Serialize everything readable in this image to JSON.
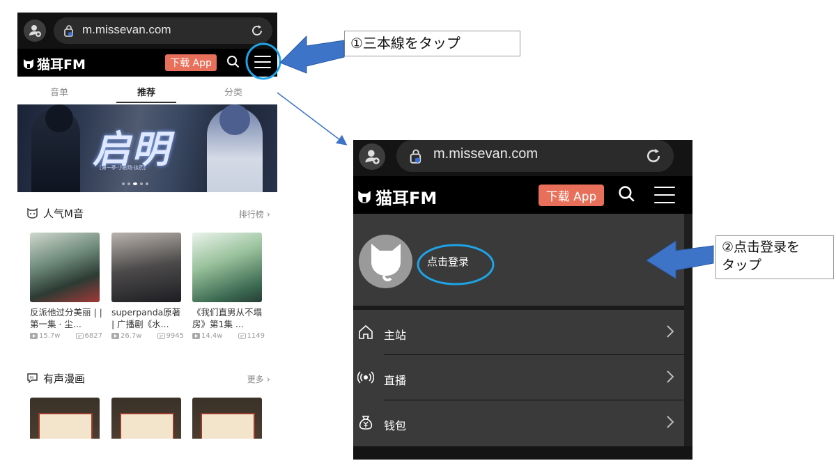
{
  "colors": {
    "accent": "#e8705a",
    "annotation_blue": "#3e74c8",
    "highlight_ring": "#1ea3e6",
    "dark_bg": "#121212",
    "panel_bg": "#3a3a3a"
  },
  "left_phone": {
    "url": "m.missevan.com",
    "app_name": "猫耳FM",
    "download_label": "下载 App",
    "tabs": [
      {
        "label": "音单",
        "active": false
      },
      {
        "label": "推荐",
        "active": true
      },
      {
        "label": "分类",
        "active": false
      }
    ],
    "banner": {
      "title": "启明",
      "subtitle": "[第一季·小剧场·挟药]"
    },
    "popular": {
      "title": "人气M音",
      "more": "排行榜",
      "cards": [
        {
          "title": "反派他过分美丽 | | 第一集 · 尘...",
          "plays": "15.7w",
          "comments": "6827"
        },
        {
          "title": "superpanda原著 | 广播剧《水...",
          "plays": "26.7w",
          "comments": "9945"
        },
        {
          "title": "《我们直男从不塌房》第1集 ...",
          "plays": "14.4w",
          "comments": "1149"
        }
      ]
    },
    "manga": {
      "title": "有声漫画",
      "more": "更多"
    }
  },
  "right_phone": {
    "url": "m.missevan.com",
    "app_name": "猫耳FM",
    "download_label": "下载 App",
    "login_label": "点击登录",
    "menu_items": [
      {
        "label": "主站",
        "icon": "home-icon"
      },
      {
        "label": "直播",
        "icon": "broadcast-icon"
      },
      {
        "label": "钱包",
        "icon": "money-bag-icon"
      }
    ]
  },
  "annotations": {
    "step1": "①三本線をタップ",
    "step2_line1": "②点击登录を",
    "step2_line2": "タップ"
  }
}
